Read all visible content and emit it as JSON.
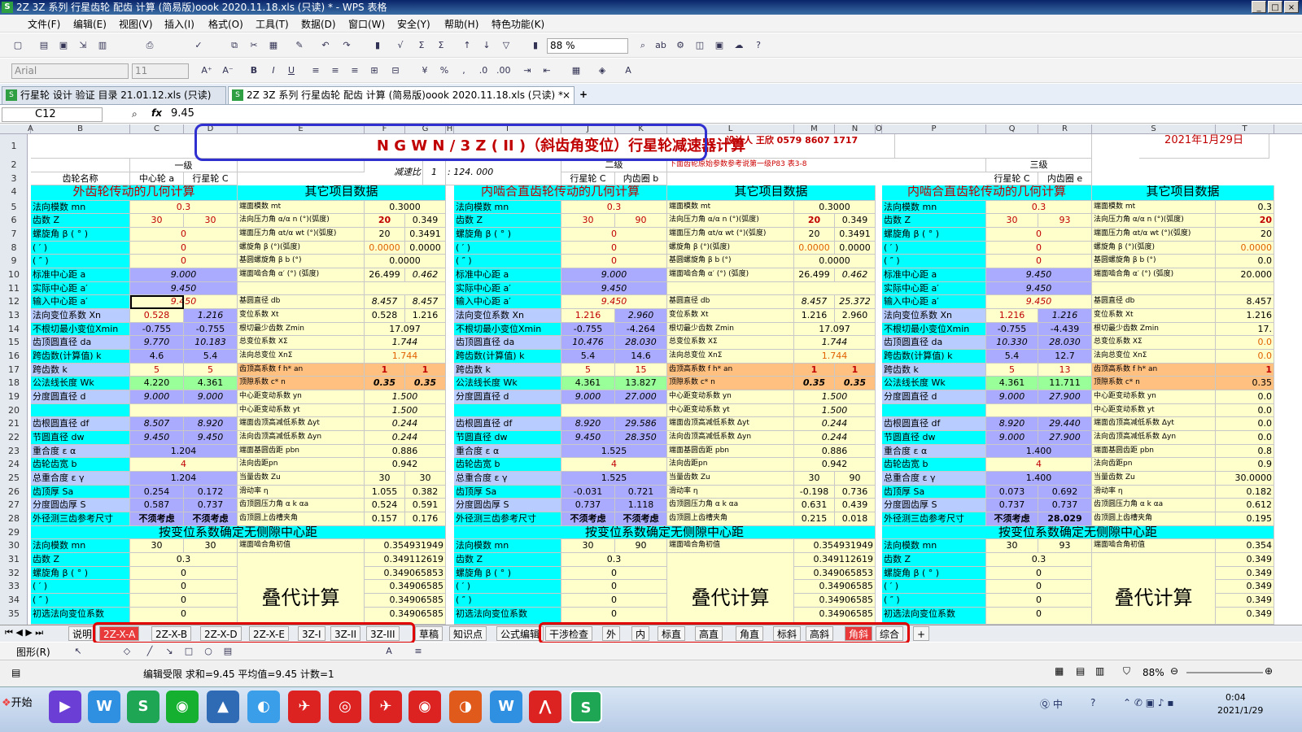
{
  "window": {
    "title": "2Z 3Z 系列 行星齿轮 配齿 计算 (简易版)oook 2020.11.18.xls (只读) * - WPS 表格",
    "logo": "S",
    "buttons": [
      "_",
      "□",
      "×"
    ]
  },
  "menu": [
    "文件(F)",
    "编辑(E)",
    "视图(V)",
    "插入(I)",
    "格式(O)",
    "工具(T)",
    "数据(D)",
    "窗口(W)",
    "安全(Y)",
    "帮助(H)",
    "特色功能(K)"
  ],
  "toolbar": {
    "zoom": "88 %",
    "font": "Arial",
    "size": "11"
  },
  "doctabs": [
    {
      "label": "行星轮 设计 验证 目录 21.01.12.xls (只读)"
    },
    {
      "label": "2Z 3Z 系列 行星齿轮 配齿 计算 (简易版)oook 2020.11.18.xls (只读) *"
    }
  ],
  "formula": {
    "cell": "C12",
    "fx": "fx",
    "value": "9.45"
  },
  "columns": [
    "A",
    "B",
    "C",
    "D",
    "E",
    "F",
    "G",
    "H",
    "I",
    "J",
    "K",
    "L",
    "M",
    "N",
    "O",
    "P",
    "Q",
    "R",
    "S",
    "T"
  ],
  "rows": [
    "1",
    "2",
    "3",
    "4",
    "5",
    "6",
    "7",
    "8",
    "9",
    "10",
    "11",
    "12",
    "13",
    "14",
    "15",
    "16",
    "17",
    "18",
    "19",
    "20",
    "21",
    "22",
    "23",
    "24",
    "25",
    "26",
    "27",
    "28",
    "29",
    "30",
    "31",
    "32",
    "33",
    "34",
    "35"
  ],
  "sheet": {
    "title": "N G W N / 3 Z ( II )（斜齿角变位）行星轮减速器计算",
    "designer": "设计人  王欣  0579 8607 1717",
    "date": "2021年1月29日",
    "stage1": "一级",
    "stage2": "二级",
    "stage3": "三级",
    "gear_name": "齿轮名称",
    "sun": "中心轮 a",
    "planet": "行星轮 C",
    "ratio_label": "减速比",
    "ratio_i": "1",
    "ratio_val": ": 124. 000",
    "planet2": "行星轮 C",
    "ring2": "内齿圈 b",
    "planet3": "行星轮 C",
    "ring3": "内齿圈 e",
    "note": "下面齿轮原始参数参考说第一级P83  表3-8",
    "sec_ext": "外齿轮传动的几何计算",
    "sec_other": "其它项目数据",
    "sec_int": "内啮合直齿轮传动的几何计算",
    "sec_center": "按变位系数确定无侧隙中心距",
    "iter": "叠代计算"
  },
  "labels_left": [
    "法向模数      mn",
    "齿数            Z",
    "螺旋角 β   (  ° )",
    "           (  ′ )",
    "           (  ″ )",
    "标准中心距     a",
    "实际中心距     a′",
    "输入中心距     a′",
    "法向变位系数 Xn",
    "不根切最小变位Xmin",
    "齿顶圆直径    da",
    "跨齿数(计算值)  k",
    "跨齿数            k",
    "公法线长度    Wk",
    "分度圆直径     d",
    "",
    "齿根圆直径     df",
    "节圆直径       dw",
    "重合度         ε α",
    "齿轮齿宽        b",
    "总重合度      ε γ",
    "齿顶厚          Sa",
    "分度圆齿厚     S",
    "外径测三齿参考尺寸"
  ],
  "labels_right": [
    "端面模数          mt",
    "法向压力角 α/α n  (°)(弧度)",
    "端面压力角 αt/α wt (°)(弧度)",
    "螺旋角 β  (°)(弧度)",
    "基圆螺旋角 β b (°)",
    "端面啮合角 α′ (°) (弧度)",
    "",
    "基圆直径  db",
    "变位系数 Xt",
    "根切最少齿数  Zmin",
    "总变位系数   XΣ",
    "法向总变位   XnΣ",
    "齿顶高系数 f  h* an",
    "顶隙系数  c* n",
    "中心距变动系数 yn",
    "中心距变动系数 yt",
    "端面齿顶高减低系数 Δyt",
    "法向齿顶高减低系数 Δyn",
    "端面基圆齿距 pbn",
    "法向齿距pn",
    "当量齿数 Zu",
    "滑动率   η",
    "齿顶圆压力角  α k  αa",
    "齿顶圆上齿槽夹角"
  ],
  "col1": {
    "mn": "0.3",
    "z": [
      "30",
      "30"
    ],
    "deg": "0",
    "min": "0",
    "sec": "0",
    "a": "9.000",
    "aw": "9.450",
    "ain": "9.450",
    "xn": [
      "0.528",
      "1.216"
    ],
    "xmin": [
      "-0.755",
      "-0.755"
    ],
    "da": [
      "9.770",
      "10.183"
    ],
    "kc": [
      "4.6",
      "5.4"
    ],
    "k": [
      "5",
      "5"
    ],
    "wk": [
      "4.220",
      "4.361"
    ],
    "d": [
      "9.000",
      "9.000"
    ],
    "df": [
      "8.507",
      "8.920"
    ],
    "dw": [
      "9.450",
      "9.450"
    ],
    "ea": "1.204",
    "b": "4",
    "eg": "1.204",
    "sa": [
      "0.254",
      "0.172"
    ],
    "s": [
      "0.587",
      "0.737"
    ],
    "ref": [
      "不须考虑",
      "不须考虑"
    ]
  },
  "other1": {
    "mt": "0.3000",
    "an": [
      "20",
      "0.349"
    ],
    "at": [
      "20",
      "0.3491"
    ],
    "beta": [
      "0.0000",
      "0.0000"
    ],
    "bb": "0.0000",
    "aw": [
      "26.499",
      "0.462"
    ],
    "db": [
      "8.457",
      "8.457"
    ],
    "xt": [
      "0.528",
      "1.216"
    ],
    "zmin": "17.097",
    "xs": "1.744",
    "xns": "1.744",
    "han": [
      "1",
      "1"
    ],
    "cn": [
      "0.35",
      "0.35"
    ],
    "yn": "1.500",
    "yt": "1.500",
    "dyt": "0.244",
    "dyn": "0.244",
    "pbn": "0.886",
    "pn": "0.942",
    "zu": [
      "30",
      "30"
    ],
    "eta": [
      "1.055",
      "0.382"
    ],
    "aa": [
      "0.524",
      "0.591"
    ],
    "slot": [
      "0.157",
      "0.176"
    ]
  },
  "col2": {
    "mn": "0.3",
    "z": [
      "30",
      "90"
    ],
    "deg": "0",
    "min": "0",
    "sec": "0",
    "a": "9.000",
    "aw": "9.450",
    "ain": "9.450",
    "xn": [
      "1.216",
      "2.960"
    ],
    "xmin": [
      "-0.755",
      "-4.264"
    ],
    "da": [
      "10.476",
      "28.030"
    ],
    "kc": [
      "5.4",
      "14.6"
    ],
    "k": [
      "5",
      "15"
    ],
    "wk": [
      "4.361",
      "13.827"
    ],
    "d": [
      "9.000",
      "27.000"
    ],
    "df": [
      "8.920",
      "29.586"
    ],
    "dw": [
      "9.450",
      "28.350"
    ],
    "ea": "1.525",
    "b": "4",
    "eg": "1.525",
    "sa": [
      "-0.031",
      "0.721"
    ],
    "s": [
      "0.737",
      "1.118"
    ],
    "ref": [
      "不须考虑",
      "不须考虑"
    ]
  },
  "other2": {
    "mt": "0.3000",
    "an": [
      "20",
      "0.349"
    ],
    "at": [
      "20",
      "0.3491"
    ],
    "beta": [
      "0.0000",
      "0.0000"
    ],
    "bb": "0.0000",
    "aw": [
      "26.499",
      "0.462"
    ],
    "db": [
      "8.457",
      "25.372"
    ],
    "xt": [
      "1.216",
      "2.960"
    ],
    "zmin": "17.097",
    "xs": "1.744",
    "xns": "1.744",
    "han": [
      "1",
      "1"
    ],
    "cn": [
      "0.35",
      "0.35"
    ],
    "yn": "1.500",
    "yt": "1.500",
    "dyt": "0.244",
    "dyn": "0.244",
    "pbn": "0.886",
    "pn": "0.942",
    "zu": [
      "30",
      "90"
    ],
    "eta": [
      "-0.198",
      "0.736"
    ],
    "aa": [
      "0.631",
      "0.439"
    ],
    "slot": [
      "0.215",
      "0.018"
    ]
  },
  "col3": {
    "mn": "0.3",
    "z": [
      "30",
      "93"
    ],
    "deg": "0",
    "min": "0",
    "sec": "0",
    "a": "9.450",
    "aw": "9.450",
    "ain": "9.450",
    "xn": [
      "1.216",
      "1.216"
    ],
    "xmin": [
      "-0.755",
      "-4.439"
    ],
    "da": [
      "10.330",
      "28.030"
    ],
    "kc": [
      "5.4",
      "12.7"
    ],
    "k": [
      "5",
      "13"
    ],
    "wk": [
      "4.361",
      "11.711"
    ],
    "d": [
      "9.000",
      "27.900"
    ],
    "df": [
      "8.920",
      "29.440"
    ],
    "dw": [
      "9.000",
      "27.900"
    ],
    "ea": "1.400",
    "b": "4",
    "eg": "1.400",
    "sa": [
      "0.073",
      "0.692"
    ],
    "s": [
      "0.737",
      "0.737"
    ],
    "ref": [
      "不须考虑",
      "28.029"
    ]
  },
  "other3": {
    "mt": "0.3",
    "an": "20",
    "at": "20",
    "beta": "0.0000",
    "bb": "0.0",
    "aw": "20.000",
    "db": "8.457",
    "xt": "1.216",
    "zmin": "17.",
    "xs": "0.0",
    "xns": "0.0",
    "han": "1",
    "cn": "0.35",
    "yn": "0.0",
    "yt": "0.0",
    "dyt": "0.0",
    "dyn": "0.0",
    "pbn": "0.8",
    "pn": "0.9",
    "zu": "30.0000",
    "eta": "0.182",
    "aa": "0.612",
    "slot": "0.195"
  },
  "lower": {
    "labels": [
      "法向模数      mn",
      "齿数            Z",
      "螺旋角 β   (  ° )",
      "           (  ′ )",
      "           (  ″ )",
      "初选法向变位系数"
    ],
    "init_label": "端面啮合角初值",
    "v1": {
      "mn": [
        "30",
        "30"
      ],
      "z": "0.3",
      "vals": [
        "0",
        "0",
        "0",
        "0"
      ]
    },
    "v2": {
      "mn": [
        "30",
        "90"
      ],
      "z": "0.3",
      "vals": [
        "0",
        "0",
        "0",
        "0"
      ]
    },
    "v3": {
      "mn": [
        "30",
        "93"
      ],
      "z": "0.3",
      "vals": [
        "0",
        "0",
        "0",
        "0"
      ]
    },
    "seq": [
      "0.354931949",
      "0.349112619",
      "0.349065853",
      "0.34906585",
      "0.34906585",
      "0.34906585"
    ],
    "seq3": [
      "0.354",
      "0.349",
      "0.349",
      "0.349",
      "0.349",
      "0.349"
    ]
  },
  "sheet_tabs": [
    "说明",
    "2Z-X-A",
    "2Z-X-B",
    "2Z-X-D",
    "2Z-X-E",
    "3Z-I",
    "3Z-II",
    "3Z-III",
    "草稿",
    "知识点",
    "公式编辑",
    "干涉检查",
    "外",
    "内",
    "标直",
    "高直",
    "角直",
    "标斜",
    "高斜",
    "角斜",
    "综合",
    "+"
  ],
  "drawbar": {
    "label": "图形(R)"
  },
  "status": {
    "text": "编辑受限   求和=9.45  平均值=9.45  计数=1",
    "zoom": "88%"
  },
  "taskbar": {
    "start": "开始",
    "time": "0:04",
    "date": "2021/1/29"
  },
  "colors": {
    "title_bar": "#0a246a",
    "cyan": "#00ffff",
    "yellow": "#ffffcc",
    "blue": "#aaaaff",
    "red": "#c00000",
    "tab_red": "#e83a3a"
  }
}
